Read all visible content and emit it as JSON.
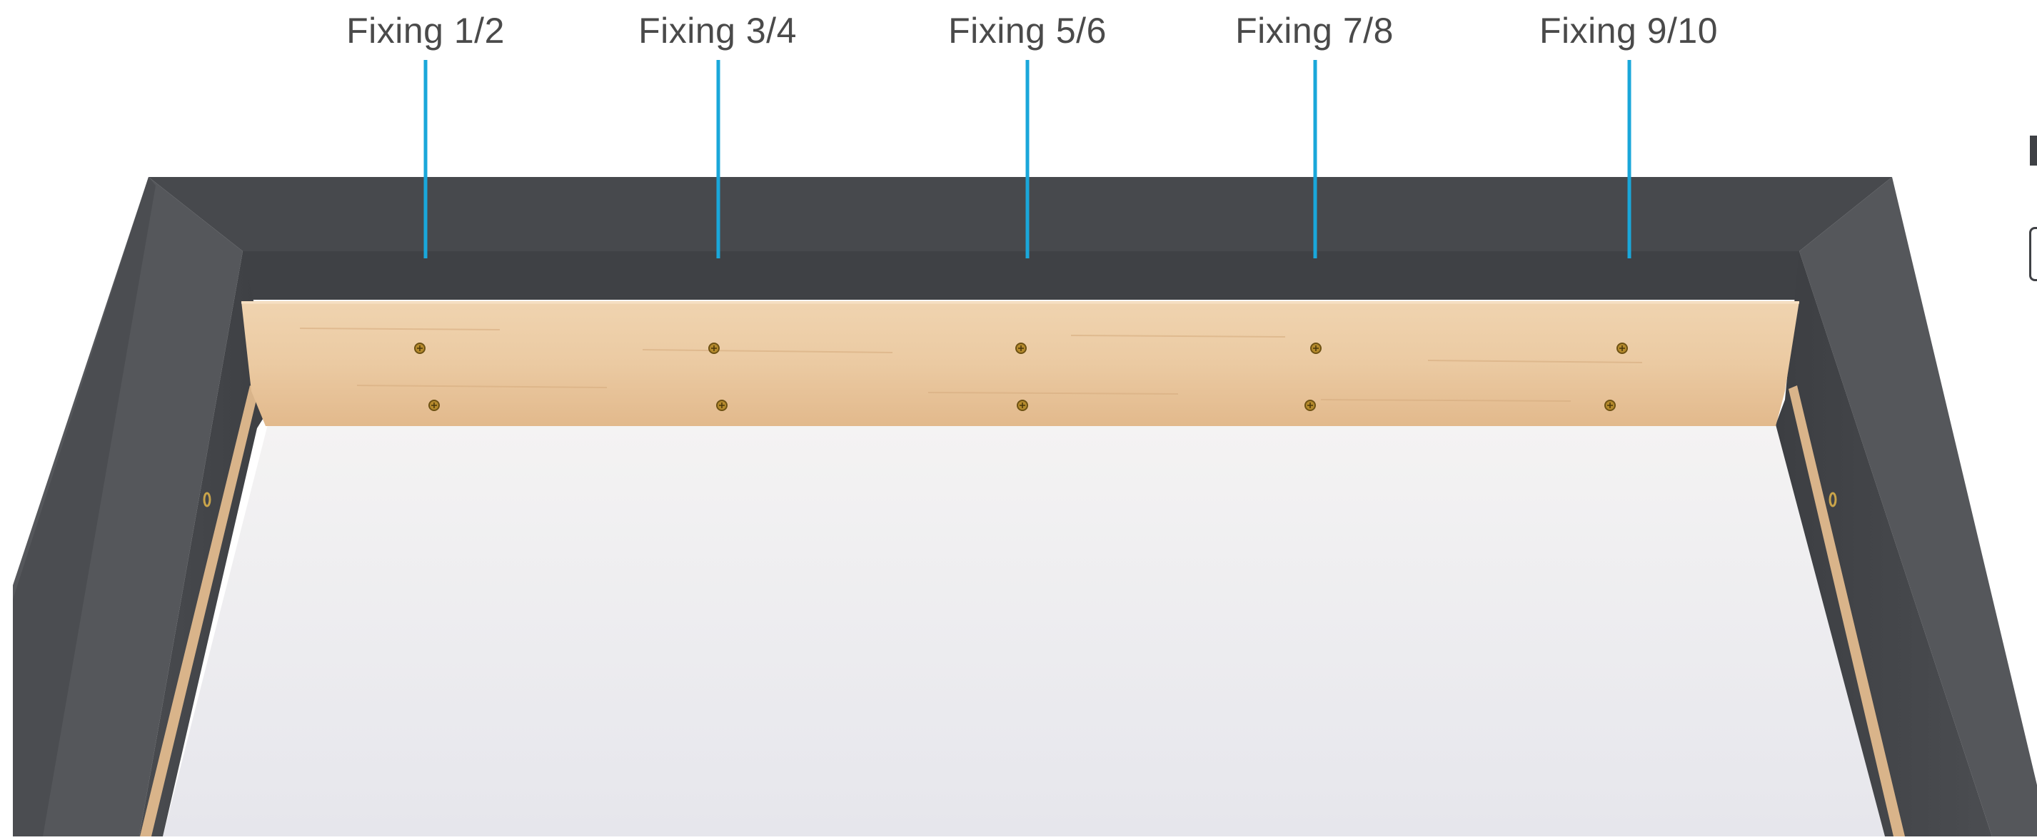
{
  "fixings": [
    {
      "label": "Fixing 1/2"
    },
    {
      "label": "Fixing 3/4"
    },
    {
      "label": "Fixing 5/6"
    },
    {
      "label": "Fixing 7/8"
    },
    {
      "label": "Fixing 9/10"
    }
  ],
  "colors": {
    "leader": "#1aa7da",
    "frame_dark": "#45474b",
    "frame_mid": "#55575b",
    "wood": "#e9c7a0",
    "floor": "#e9e9ee"
  }
}
